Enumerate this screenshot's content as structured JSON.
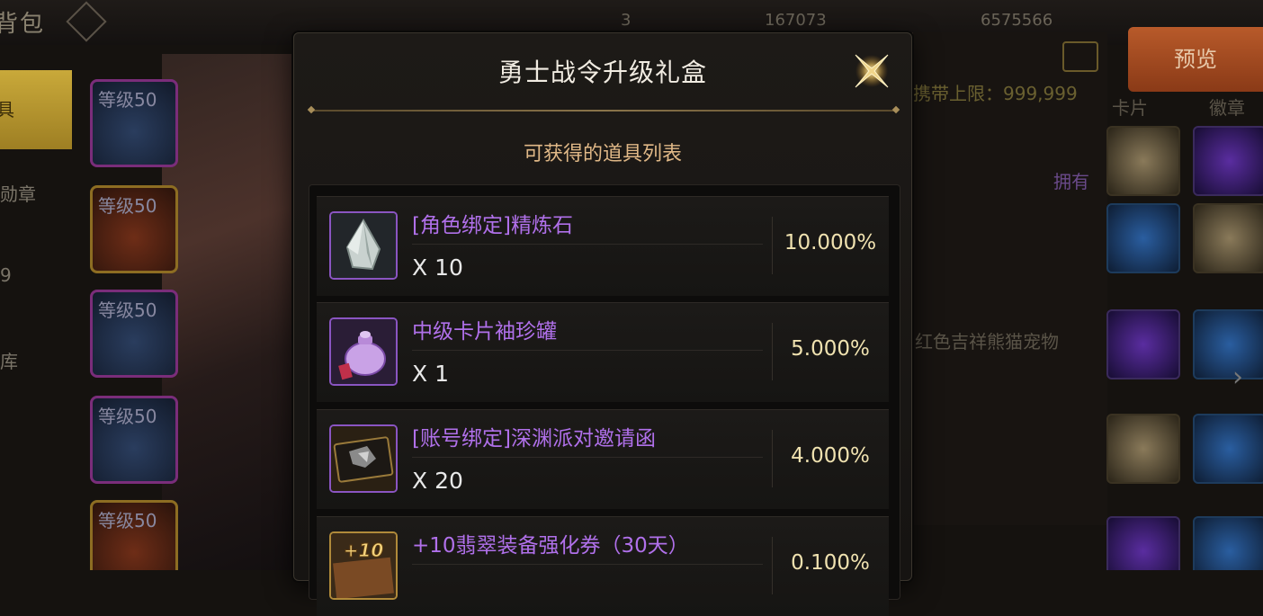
{
  "background": {
    "bag_title": "背包",
    "side_tabs": [
      "具",
      "勋章",
      "9",
      "库"
    ],
    "top_values": [
      "3",
      "167073",
      "6575566"
    ],
    "slot_level": "等级50",
    "carry_limit": "携带上限：999,999",
    "col_headers": [
      "卡片",
      "徽章"
    ],
    "owned_label": "拥有",
    "pet_text": "红色吉祥熊猫宠物",
    "preview_button": "预览"
  },
  "modal": {
    "title": "勇士战令升级礼盒",
    "subtitle": "可获得的道具列表",
    "items": [
      {
        "name": "[角色绑定]精炼石",
        "qty": "X 10",
        "pct": "10.000%",
        "icon": "crystal-icon"
      },
      {
        "name": "中级卡片袖珍罐",
        "qty": "X 1",
        "pct": "5.000%",
        "icon": "jar-icon"
      },
      {
        "name": "[账号绑定]深渊派对邀请函",
        "qty": "X 20",
        "pct": "4.000%",
        "icon": "invitation-icon"
      },
      {
        "name": "+10翡翠装备强化券（30天）",
        "qty": "",
        "pct": "0.100%",
        "icon": "enhance-ticket-icon",
        "badge": "+10"
      }
    ]
  },
  "colors": {
    "item_name": "#b070ea",
    "percent": "#f0e2b0",
    "subtitle": "#e0b887"
  }
}
